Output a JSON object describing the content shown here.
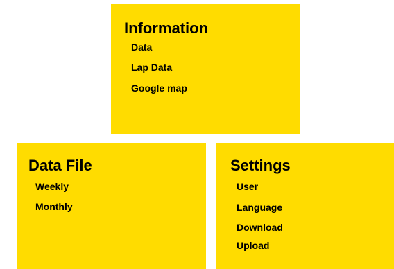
{
  "panel_color": "#ffdc00",
  "panels": {
    "information": {
      "title": "Information",
      "items": [
        "Data",
        "Lap Data",
        "Google map"
      ]
    },
    "data_file": {
      "title": "Data File",
      "items": [
        "Weekly",
        "Monthly"
      ]
    },
    "settings": {
      "title": "Settings",
      "items": [
        "User",
        "Language",
        "Download",
        "Upload"
      ]
    }
  }
}
